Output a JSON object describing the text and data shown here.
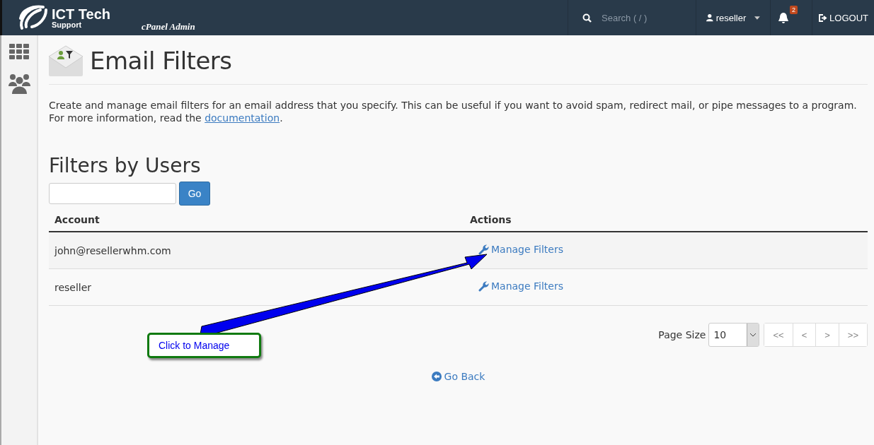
{
  "header": {
    "logo_title": "ICT Tech",
    "logo_subtitle": "Support",
    "logo_tagline": "cPanel Admin",
    "search": {
      "placeholder": "Search ( / )"
    },
    "user": "reseller",
    "notifications": "2",
    "logout": "LOGOUT"
  },
  "page": {
    "title": "Email Filters",
    "description": "Create and manage email filters for an email address that you specify. This can be useful if you want to avoid spam, redirect mail, or pipe messages to a program. For more information, read the ",
    "description_link": "documentation",
    "description_end": "."
  },
  "filters": {
    "heading": "Filters by Users",
    "go_button": "Go"
  },
  "table": {
    "columns": [
      "Account",
      "Actions"
    ],
    "rows": [
      {
        "account": "john@resellerwhm.com",
        "action": "Manage Filters"
      },
      {
        "account": "reseller",
        "action": "Manage Filters"
      }
    ]
  },
  "pagination": {
    "label": "Page Size",
    "page_size": "10",
    "buttons": [
      "<<",
      "<",
      ">",
      ">>"
    ]
  },
  "go_back": "Go Back",
  "callout": "Click to Manage"
}
